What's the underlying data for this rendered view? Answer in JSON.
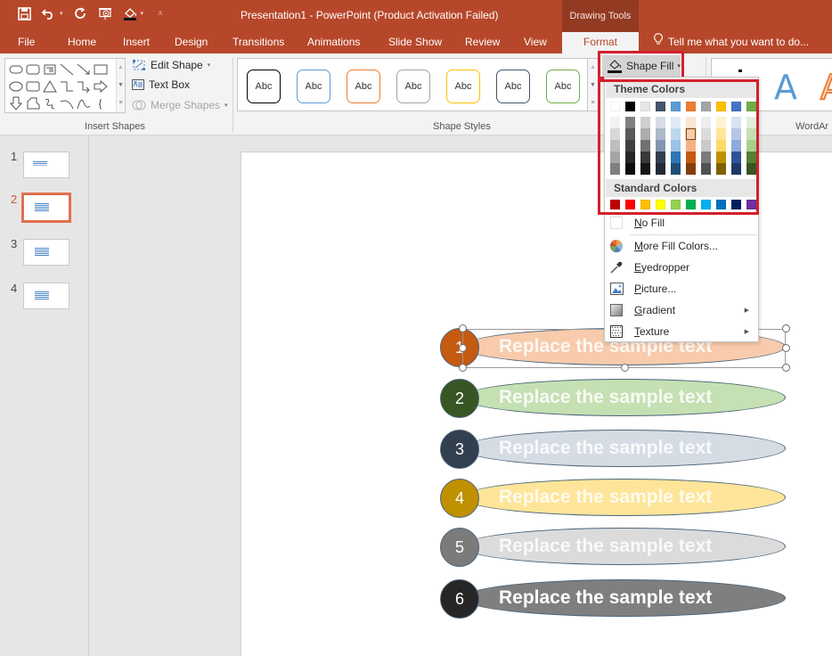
{
  "app": {
    "title": "Presentation1 - PowerPoint (Product Activation Failed)",
    "context_tab_group": "Drawing Tools",
    "brand_color": "#b7472a"
  },
  "qat": {
    "icons": [
      "save-icon",
      "undo-icon",
      "redo-icon",
      "slideshow-icon",
      "shape-fill-icon",
      "customize-qat-icon"
    ]
  },
  "tabs": [
    {
      "label": "File"
    },
    {
      "label": "Home"
    },
    {
      "label": "Insert"
    },
    {
      "label": "Design"
    },
    {
      "label": "Transitions"
    },
    {
      "label": "Animations"
    },
    {
      "label": "Slide Show"
    },
    {
      "label": "Review"
    },
    {
      "label": "View"
    },
    {
      "label": "Format",
      "active": true
    }
  ],
  "tell_me": "Tell me what you want to do...",
  "ribbon": {
    "insert_shapes": {
      "label": "Insert Shapes",
      "edit_shape": "Edit Shape",
      "text_box": "Text Box",
      "merge_shapes": "Merge Shapes"
    },
    "shape_styles": {
      "label": "Shape Styles",
      "items": [
        {
          "label": "Abc",
          "color": "#000000"
        },
        {
          "label": "Abc",
          "color": "#5b9bd5"
        },
        {
          "label": "Abc",
          "color": "#ed7d31"
        },
        {
          "label": "Abc",
          "color": "#a5a5a5"
        },
        {
          "label": "Abc",
          "color": "#ffc000"
        },
        {
          "label": "Abc",
          "color": "#44546a"
        },
        {
          "label": "Abc",
          "color": "#70ad47"
        }
      ],
      "shape_fill": "Shape Fill"
    },
    "wordart": {
      "label": "WordArt Styles",
      "label_visible": "WordAr"
    }
  },
  "shape_fill_menu": {
    "theme_colors_label": "Theme Colors",
    "standard_colors_label": "Standard Colors",
    "theme_top": [
      "#ffffff",
      "#000000",
      "#e7e6e6",
      "#44546a",
      "#5b9bd5",
      "#ed7d31",
      "#a5a5a5",
      "#ffc000",
      "#4472c4",
      "#70ad47"
    ],
    "theme_shades": [
      [
        "#f2f2f2",
        "#7f7f7f",
        "#d0cece",
        "#d6dce4",
        "#deebf6",
        "#fbe5d5",
        "#ededed",
        "#fff2cc",
        "#d9e2f3",
        "#e2efd9"
      ],
      [
        "#d8d8d8",
        "#595959",
        "#aeabab",
        "#adb9ca",
        "#bdd7ee",
        "#f7cbac",
        "#dbdbdb",
        "#fee599",
        "#b4c6e7",
        "#c5e0b3"
      ],
      [
        "#bfbfbf",
        "#3f3f3f",
        "#757070",
        "#8496b0",
        "#9dc3e6",
        "#f4b183",
        "#c9c9c9",
        "#ffd965",
        "#8eaadb",
        "#a8d08d"
      ],
      [
        "#a5a5a5",
        "#262626",
        "#3a3838",
        "#323f4f",
        "#2e75b5",
        "#c55a11",
        "#7b7b7b",
        "#bf9000",
        "#2f5496",
        "#538135"
      ],
      [
        "#7f7f7f",
        "#0c0c0c",
        "#171616",
        "#222a35",
        "#1e4e79",
        "#843c0b",
        "#525252",
        "#7f6000",
        "#1f3864",
        "#375623"
      ]
    ],
    "selected": {
      "row": 1,
      "col": 5
    },
    "standard": [
      "#c00000",
      "#ff0000",
      "#ffc000",
      "#ffff00",
      "#92d050",
      "#00b050",
      "#00b0f0",
      "#0070c0",
      "#002060",
      "#7030a0"
    ],
    "items": [
      {
        "label": "No Fill",
        "accel": "N",
        "icon": "no-fill-icon"
      },
      {
        "label": "More Fill Colors...",
        "accel": "M",
        "icon": "color-wheel-icon"
      },
      {
        "label": "Eyedropper",
        "accel": "E",
        "icon": "eyedropper-icon"
      },
      {
        "label": "Picture...",
        "accel": "P",
        "icon": "picture-icon"
      },
      {
        "label": "Gradient",
        "accel": "G",
        "icon": "gradient-icon",
        "submenu": true
      },
      {
        "label": "Texture",
        "accel": "T",
        "icon": "texture-icon",
        "submenu": true
      }
    ]
  },
  "slides_panel": [
    {
      "number": "1"
    },
    {
      "number": "2",
      "active": true
    },
    {
      "number": "3"
    },
    {
      "number": "4"
    }
  ],
  "slide": {
    "rows": [
      {
        "number": "1",
        "text": "Replace the sample text",
        "circle": "#c55a11",
        "pill": "#f7cbac",
        "selected": true
      },
      {
        "number": "2",
        "text": "Replace the sample text",
        "circle": "#375623",
        "pill": "#c5e0b3"
      },
      {
        "number": "3",
        "text": "Replace the sample text",
        "circle": "#323f4f",
        "pill": "#d6dce4"
      },
      {
        "number": "4",
        "text": "Replace the sample text",
        "circle": "#bf9000",
        "pill": "#fee599"
      },
      {
        "number": "5",
        "text": "Replace the sample text",
        "circle": "#7b7b7b",
        "pill": "#dbdbdb"
      },
      {
        "number": "6",
        "text": "Replace the sample text",
        "circle": "#262626",
        "pill": "#7f7f7f"
      }
    ]
  }
}
